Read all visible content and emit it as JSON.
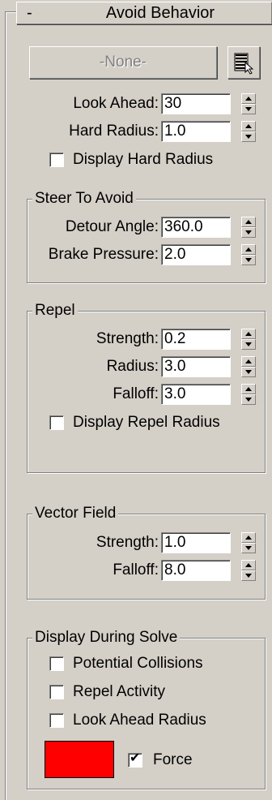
{
  "rollout": {
    "toggle": "-",
    "title": "Avoid Behavior"
  },
  "pick_button": {
    "label": "-None-"
  },
  "list_button": {
    "icon": "list-select-icon"
  },
  "look_ahead": {
    "label": "Look Ahead:",
    "value": "30"
  },
  "hard_radius": {
    "label": "Hard Radius:",
    "value": "1.0"
  },
  "display_hard_radius": {
    "label": "Display Hard Radius",
    "checked": false
  },
  "steer_to_avoid": {
    "title": "Steer To Avoid",
    "detour_angle": {
      "label": "Detour Angle:",
      "value": "360.0"
    },
    "brake_pressure": {
      "label": "Brake Pressure:",
      "value": "2.0"
    }
  },
  "repel": {
    "title": "Repel",
    "strength": {
      "label": "Strength:",
      "value": "0.2"
    },
    "radius": {
      "label": "Radius:",
      "value": "3.0"
    },
    "falloff": {
      "label": "Falloff:",
      "value": "3.0"
    },
    "display_repel_radius": {
      "label": "Display Repel Radius",
      "checked": false
    }
  },
  "vector_field": {
    "title": "Vector Field",
    "strength": {
      "label": "Strength:",
      "value": "1.0"
    },
    "falloff": {
      "label": "Falloff:",
      "value": "8.0"
    }
  },
  "display_during_solve": {
    "title": "Display During Solve",
    "potential_collisions": {
      "label": "Potential Collisions",
      "checked": false
    },
    "repel_activity": {
      "label": "Repel Activity",
      "checked": false
    },
    "look_ahead_radius": {
      "label": "Look Ahead Radius",
      "checked": false
    },
    "force_color": "#ff0000",
    "force": {
      "label": "Force",
      "checked": true
    }
  }
}
